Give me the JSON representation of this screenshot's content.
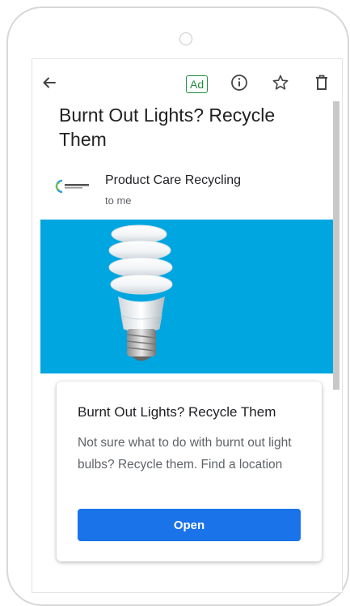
{
  "toolbar": {
    "ad_label": "Ad",
    "icons": [
      "back-arrow-icon",
      "info-icon",
      "star-icon",
      "trash-icon"
    ]
  },
  "email": {
    "subject": "Burnt Out Lights? Recycle Them",
    "sender": "Product Care Recycling",
    "recipient": "to me"
  },
  "card": {
    "title": "Burnt Out Lights? Recycle Them",
    "body": "Not sure what to do with burnt out light bulbs? Recycle them. Find a location",
    "button_label": "Open"
  },
  "colors": {
    "hero_background": "#00a6e0",
    "button": "#1a73e8",
    "ad_badge": "#1e8e3e"
  }
}
